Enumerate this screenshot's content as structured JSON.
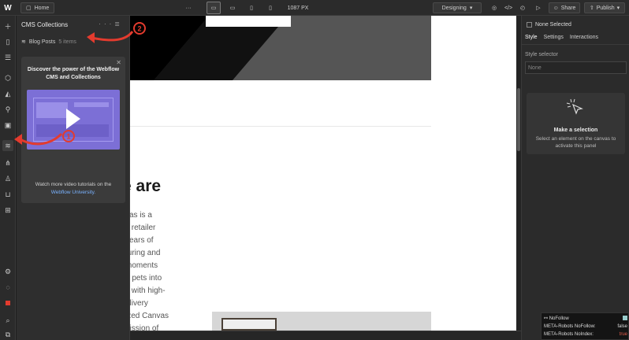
{
  "topbar": {
    "logo": "W",
    "home": "Home",
    "more": "···",
    "width": "1087 PX",
    "mode": "Designing",
    "share": "Share",
    "publish": "Publish"
  },
  "cms": {
    "title": "CMS Collections",
    "collection_name": "Blog Posts",
    "collection_count": "5 items",
    "promo_title": "Discover the power of the Webflow CMS and Collections",
    "promo_foot": "Watch more video tutorials on the",
    "promo_link": "Webflow University."
  },
  "canvas": {
    "heading": "e are",
    "para_lines": [
      "vas is a",
      "s retailer",
      "years of",
      "turing and",
      "moments",
      "e pets into",
      "s with high-",
      "elivery",
      "ized Canvas",
      "nission of"
    ]
  },
  "right": {
    "none_selected": "None Selected",
    "tabs": [
      "Style",
      "Settings",
      "Interactions"
    ],
    "selector_label": "Style selector",
    "selector_value": "None",
    "make_title": "Make a selection",
    "make_sub": "Select an element on the canvas to activate this panel"
  },
  "seo": {
    "title": "NoFollow",
    "row1_label": "META-Robots NoFollow:",
    "row1_value": "false",
    "row2_label": "META-Robots NoIndex:",
    "row2_value": "true"
  },
  "annotations": [
    "1",
    "2"
  ],
  "colors": {
    "annotation": "#e33b2e",
    "video": "#7c6fd6",
    "link": "#7ab3ff"
  }
}
